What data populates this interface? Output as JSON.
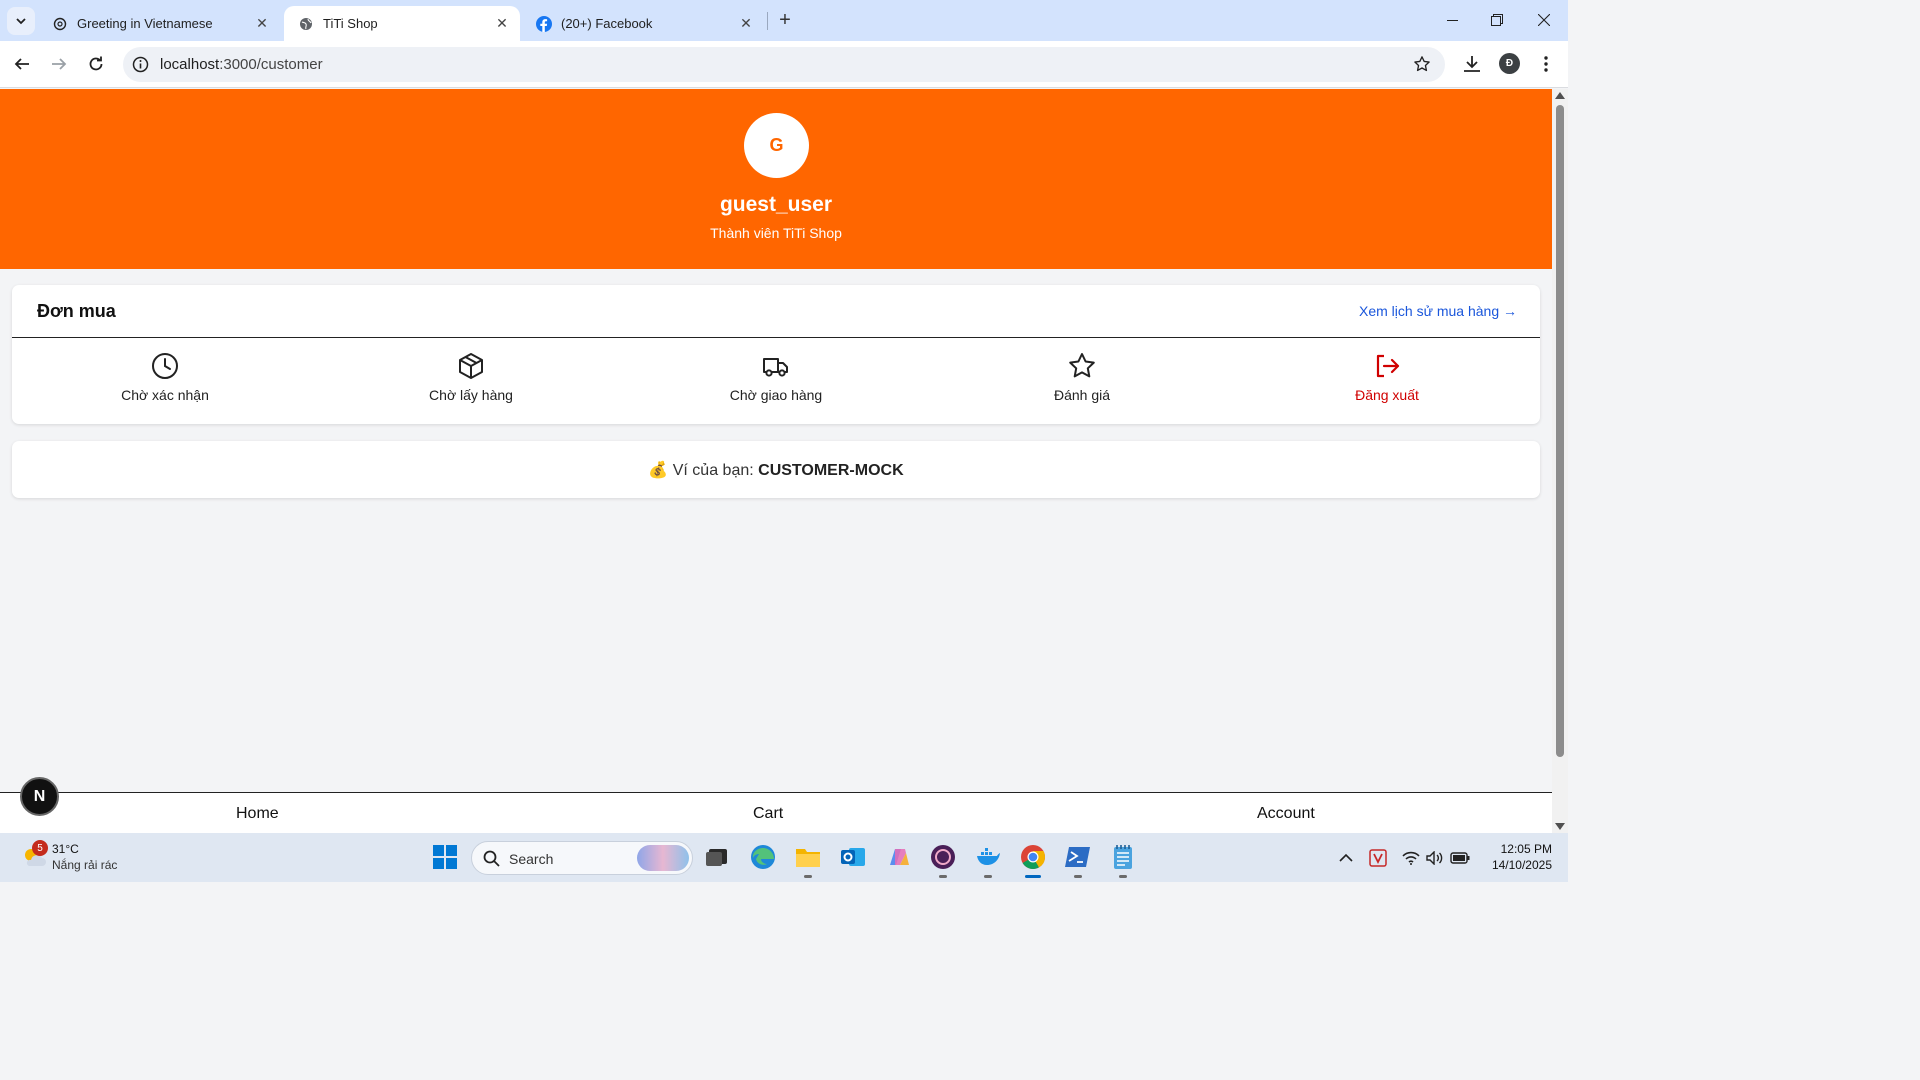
{
  "browser": {
    "tabs": [
      {
        "title": "Greeting in Vietnamese",
        "icon": "openai-icon",
        "active": false
      },
      {
        "title": "TiTi Shop",
        "icon": "globe-icon",
        "active": true
      },
      {
        "title": "(20+) Facebook",
        "icon": "facebook-icon",
        "active": false
      }
    ],
    "url_host": "localhost",
    "url_path": ":3000/customer",
    "profile_initial": "Đ"
  },
  "profile": {
    "avatar_letter": "G",
    "username": "guest_user",
    "member_label": "Thành viên TiTi Shop"
  },
  "orders": {
    "title": "Đơn mua",
    "history_link": "Xem lịch sử mua hàng →",
    "statuses": [
      {
        "label": "Chờ xác nhận",
        "icon": "clock-icon"
      },
      {
        "label": "Chờ lấy hàng",
        "icon": "package-icon"
      },
      {
        "label": "Chờ giao hàng",
        "icon": "truck-icon"
      },
      {
        "label": "Đánh giá",
        "icon": "star-icon"
      },
      {
        "label": "Đăng xuất",
        "icon": "logout-icon"
      }
    ]
  },
  "wallet": {
    "emoji": "💰",
    "label": "Ví của bạn:",
    "value": "CUSTOMER-MOCK"
  },
  "next_badge": "N",
  "bottom_nav": {
    "home": "Home",
    "cart": "Cart",
    "account": "Account"
  },
  "taskbar": {
    "weather_temp": "31°C",
    "weather_condition": "Nắng rải rác",
    "weather_badge": "5",
    "search_label": "Search",
    "time": "12:05 PM",
    "date": "14/10/2025"
  },
  "colors": {
    "brand_orange": "#ff6600",
    "link_blue": "#1a56db",
    "logout_red": "#d00000"
  }
}
